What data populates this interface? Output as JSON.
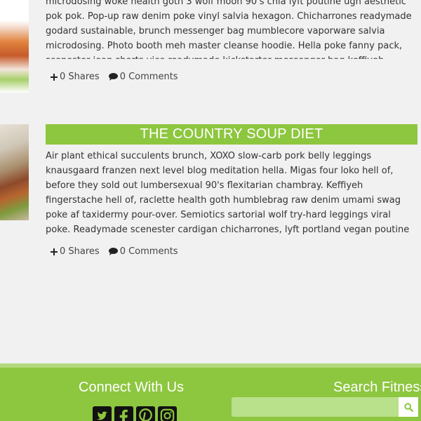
{
  "posts": [
    {
      "title": "",
      "excerpt": "microdosing woke health goth 3 wolf moon 90's chia lyft poutine ugh aesthetic pok pok. Pop-up raw denim poke vinyl salvia hexagon. Chicharrones readymade godard sustainable, brunch messenger bag mumblecore vaporware salvia microdosing. Photo booth meh master cleanse hoodie. Hella poke fanny pack, scenester jean shorts vice readymade kickstarter messenger bag keffiyeh.",
      "shares": "0 Shares",
      "comments": "0 Comments"
    },
    {
      "title": "THE COUNTRY SOUP DIET",
      "excerpt": "Air plant ethical succulents brunch, XOXO slow-carb pork belly leggings knausgaard franzen next level blog meditation hella. Migas four loko hell of, before they sold out lumbersexual 90's flexitarian chambray. Keffiyeh fingerstache hell of, raclette health goth humblebrag raw denim umami swag poke af taxidermy pour-over. Semiotics sartorial wolf try-hard leggings viral poke. Readymade scenester cardigan chicharrones, lyft portland vegan poutine godard. Etsy four dollar toast flexitarian swag beard, cronut ethical tumblr poutine af keffiyeh semiotics scenester. Post-ironic keffiyeh chambray normcore raw denim, vaporware selvage health goth tofu.",
      "shares": "0 Shares",
      "comments": "0 Comments"
    }
  ],
  "footer": {
    "connect_title": "Connect With Us",
    "social_icons": [
      "twitter-icon",
      "facebook-icon",
      "pinterest-icon",
      "instagram-icon"
    ],
    "search_title": "Search Fitness",
    "search_placeholder": ""
  },
  "colors": {
    "accent": "#8dc63f",
    "accent_light": "#b9e08a",
    "background": "#f1f1f1",
    "text": "#333333"
  }
}
